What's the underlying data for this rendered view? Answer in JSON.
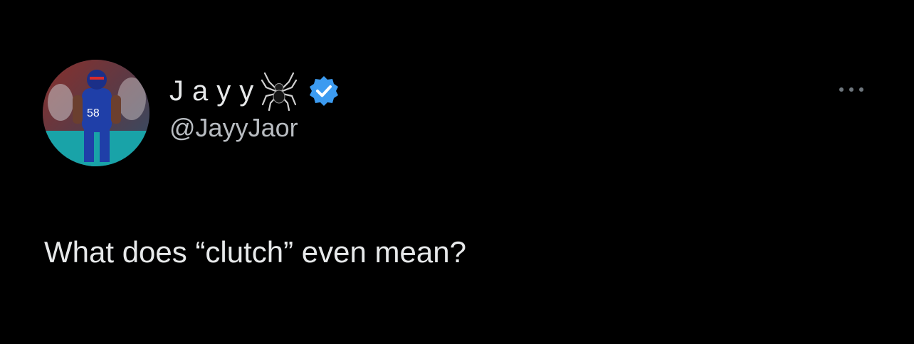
{
  "tweet": {
    "author": {
      "display_name": "Jayy",
      "handle": "@JayyJaor",
      "name_emoji": "spider-icon",
      "verified": true,
      "verified_color": "#3c9bf0"
    },
    "text": "What does “clutch” even mean?",
    "more_icon": "more-options-icon"
  },
  "theme": {
    "background": "#000000",
    "text_primary": "#e7e9ea",
    "text_secondary": "#b8bcc1"
  }
}
